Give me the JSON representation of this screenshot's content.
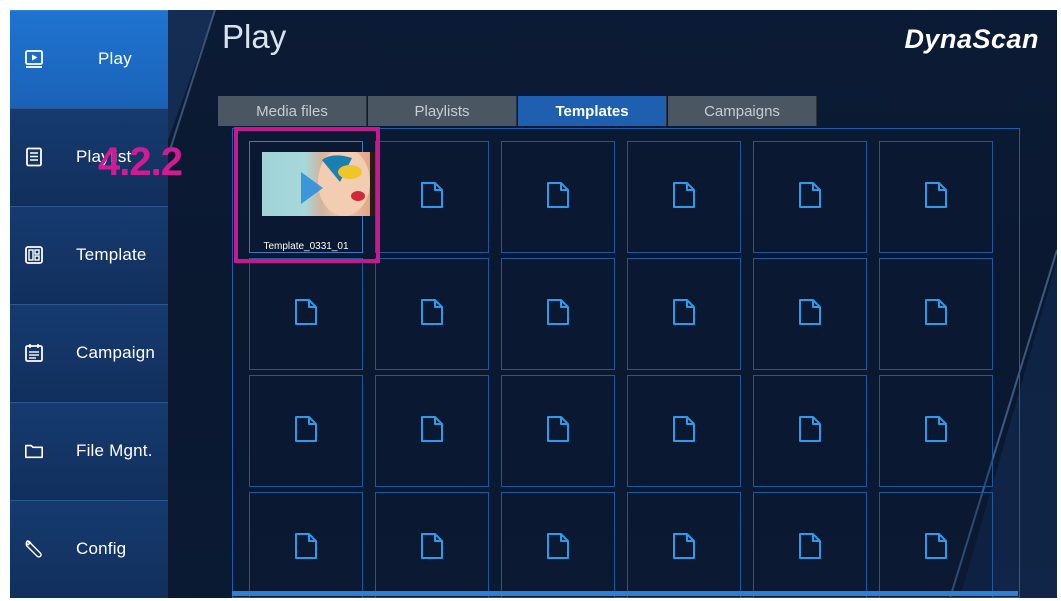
{
  "header": {
    "title": "Play",
    "brand": "DynaScan"
  },
  "sidebar": {
    "items": [
      {
        "label": "Play",
        "icon": "play-screen-icon"
      },
      {
        "label": "Playlist",
        "icon": "list-document-icon"
      },
      {
        "label": "Template",
        "icon": "layout-grid-icon"
      },
      {
        "label": "Campaign",
        "icon": "calendar-list-icon"
      },
      {
        "label": "File Mgnt.",
        "icon": "folder-icon"
      },
      {
        "label": "Config",
        "icon": "wrench-icon"
      }
    ]
  },
  "tabs": [
    {
      "label": "Media files"
    },
    {
      "label": "Playlists"
    },
    {
      "label": "Templates"
    },
    {
      "label": "Campaigns"
    }
  ],
  "grid": {
    "selected_item": {
      "label": "Template_0331_01"
    }
  },
  "annotation": {
    "step": "4.2.2"
  },
  "colors": {
    "accent": "#1f74d0",
    "highlight": "#c6198f",
    "background": "#0b1a33",
    "file_icon": "#2f9ae8"
  }
}
